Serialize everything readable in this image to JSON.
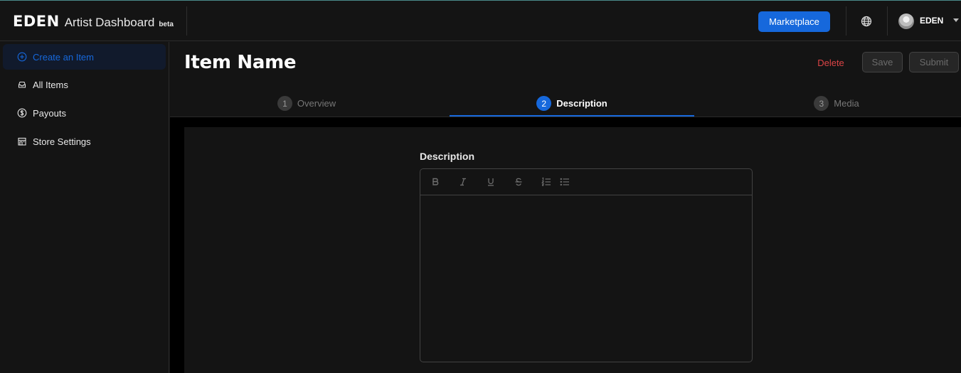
{
  "brand": {
    "logo": "EDEN",
    "title": "Artist Dashboard",
    "badge": "beta"
  },
  "header": {
    "marketplace_label": "Marketplace",
    "user_name": "EDEN",
    "accent_color": "#1668dc"
  },
  "sidebar": {
    "items": [
      {
        "label": "Create an Item",
        "icon": "plus-circle-icon",
        "active": true
      },
      {
        "label": "All Items",
        "icon": "inbox-icon",
        "active": false
      },
      {
        "label": "Payouts",
        "icon": "dollar-circle-icon",
        "active": false
      },
      {
        "label": "Store Settings",
        "icon": "shop-icon",
        "active": false
      }
    ]
  },
  "main": {
    "title": "Item Name",
    "actions": {
      "delete_label": "Delete",
      "save_label": "Save",
      "submit_label": "Submit"
    },
    "steps": [
      {
        "number": "1",
        "label": "Overview",
        "active": false
      },
      {
        "number": "2",
        "label": "Description",
        "active": true
      },
      {
        "number": "3",
        "label": "Media",
        "active": false
      }
    ],
    "description": {
      "label": "Description",
      "toolbar": [
        "bold-icon",
        "italic-icon",
        "underline-icon",
        "strikethrough-icon",
        "ordered-list-icon",
        "bullet-list-icon"
      ],
      "value": ""
    }
  }
}
